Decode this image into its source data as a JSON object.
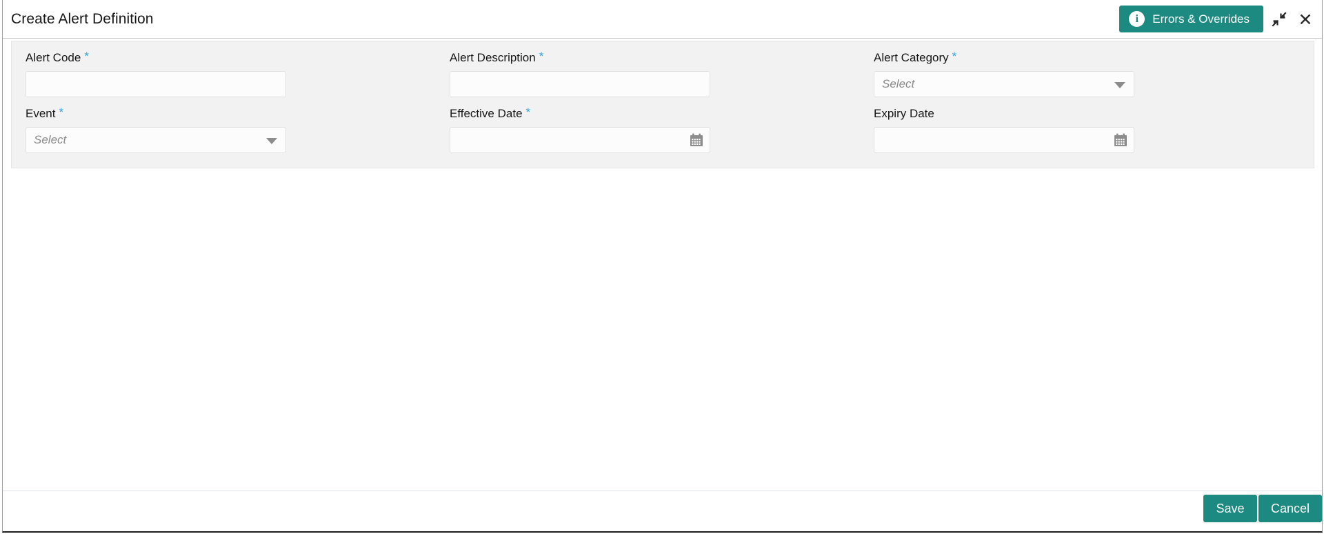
{
  "window": {
    "title": "Create Alert Definition",
    "accent_color": "#1c8a80",
    "required_marker_color": "#2ca5dd",
    "panel_background": "#f2f2f2"
  },
  "header": {
    "errors_button_label": "Errors & Overrides",
    "info_icon_glyph": "i",
    "collapse_icon": "collapse-arrows-icon",
    "close_icon_glyph": "✕"
  },
  "form": {
    "required_star": "*",
    "fields": [
      {
        "label": "Alert Code",
        "required": true,
        "type": "text",
        "value": "",
        "placeholder": ""
      },
      {
        "label": "Alert Description",
        "required": true,
        "type": "text",
        "value": "",
        "placeholder": ""
      },
      {
        "label": "Alert Category",
        "required": true,
        "type": "select",
        "value": "Select"
      },
      {
        "label": "Event",
        "required": true,
        "type": "select",
        "value": "Select"
      },
      {
        "label": "Effective Date",
        "required": true,
        "type": "date",
        "value": "",
        "placeholder": ""
      },
      {
        "label": "Expiry Date",
        "required": false,
        "type": "date",
        "value": "",
        "placeholder": ""
      }
    ]
  },
  "footer": {
    "save_label": "Save",
    "cancel_label": "Cancel"
  }
}
